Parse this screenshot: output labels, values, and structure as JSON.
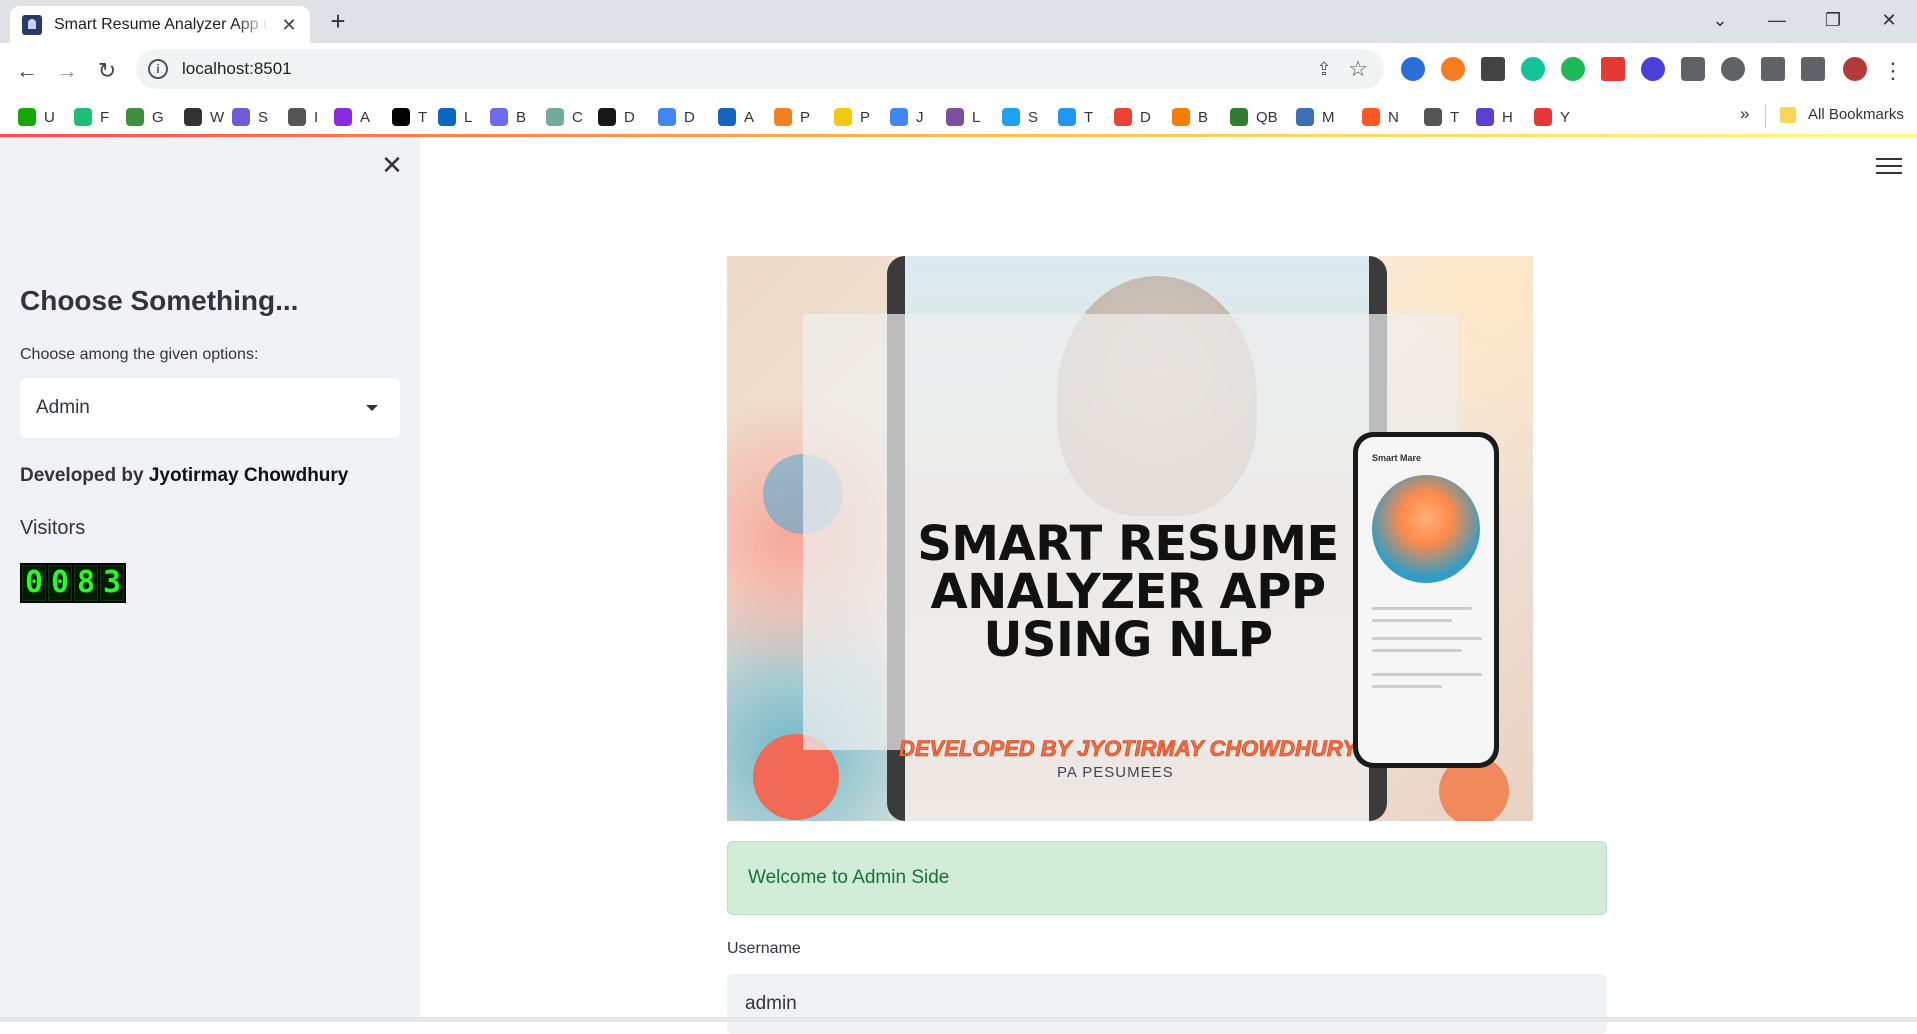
{
  "browser": {
    "tab_title": "Smart Resume Analyzer App using NLP",
    "tab_close": "✕",
    "new_tab": "+",
    "url": "localhost:8501",
    "window_controls": {
      "dropdown": "⌄",
      "minimize": "—",
      "restore": "❐",
      "close": "✕"
    },
    "bookmarks": [
      {
        "label": "U",
        "color": "#14a800"
      },
      {
        "label": "F",
        "color": "#1dbf73"
      },
      {
        "label": "G",
        "color": "#3f8f3f"
      },
      {
        "label": "W",
        "color": "#333333"
      },
      {
        "label": "S",
        "color": "#6e5bd8"
      },
      {
        "label": "I",
        "color": "#555555"
      },
      {
        "label": "A",
        "color": "#8a2be2"
      },
      {
        "label": "T",
        "color": "#000000"
      },
      {
        "label": "L",
        "color": "#0a66c2"
      },
      {
        "label": "B",
        "color": "#6b6bf0"
      },
      {
        "label": "C",
        "color": "#74aa9c"
      },
      {
        "label": "D",
        "color": "#181717"
      },
      {
        "label": "D",
        "color": "#4285f4"
      },
      {
        "label": "A",
        "color": "#1565c0"
      },
      {
        "label": "P",
        "color": "#f48120"
      },
      {
        "label": "P",
        "color": "#f2c811"
      },
      {
        "label": "J",
        "color": "#4285f4"
      },
      {
        "label": "L",
        "color": "#7b4fa0"
      },
      {
        "label": "S",
        "color": "#1da1f2"
      },
      {
        "label": "T",
        "color": "#2196f3"
      },
      {
        "label": "D",
        "color": "#ea4335"
      },
      {
        "label": "B",
        "color": "#f57d00"
      },
      {
        "label": "QB",
        "color": "#2e7d32"
      },
      {
        "label": "M",
        "color": "#3b6fb6"
      },
      {
        "label": "N",
        "color": "#ff5722"
      },
      {
        "label": "T",
        "color": "#555555"
      },
      {
        "label": "H",
        "color": "#5a3fd0"
      },
      {
        "label": "Y",
        "color": "#e53935"
      }
    ],
    "bookmarks_more": "»",
    "all_bookmarks": "All Bookmarks"
  },
  "sidebar": {
    "close_glyph": "✕",
    "heading": "Choose Something...",
    "select_label": "Choose among the given options:",
    "select_value": "Admin",
    "developed_by_prefix": "Developed by ",
    "developer_name": "Jyotirmay Chowdhury",
    "visitors_label": "Visitors",
    "visitor_digits": [
      "0",
      "0",
      "8",
      "3"
    ]
  },
  "main": {
    "hero": {
      "title": "SMART RESUME ANALYZER APP USING NLP",
      "subtitle": "DEVELOPED BY JYOTIRMAY CHOWDHURY",
      "phone_title": "Smart Mare",
      "bottom_text": "PA PESUMEES"
    },
    "welcome_message": "Welcome to Admin Side",
    "username_label": "Username",
    "username_value": "admin"
  },
  "colors": {
    "accent": "#ff4b4b",
    "sidebar_bg": "#f0f2f6",
    "success_bg": "#d1ecd9",
    "success_text": "#177233"
  }
}
